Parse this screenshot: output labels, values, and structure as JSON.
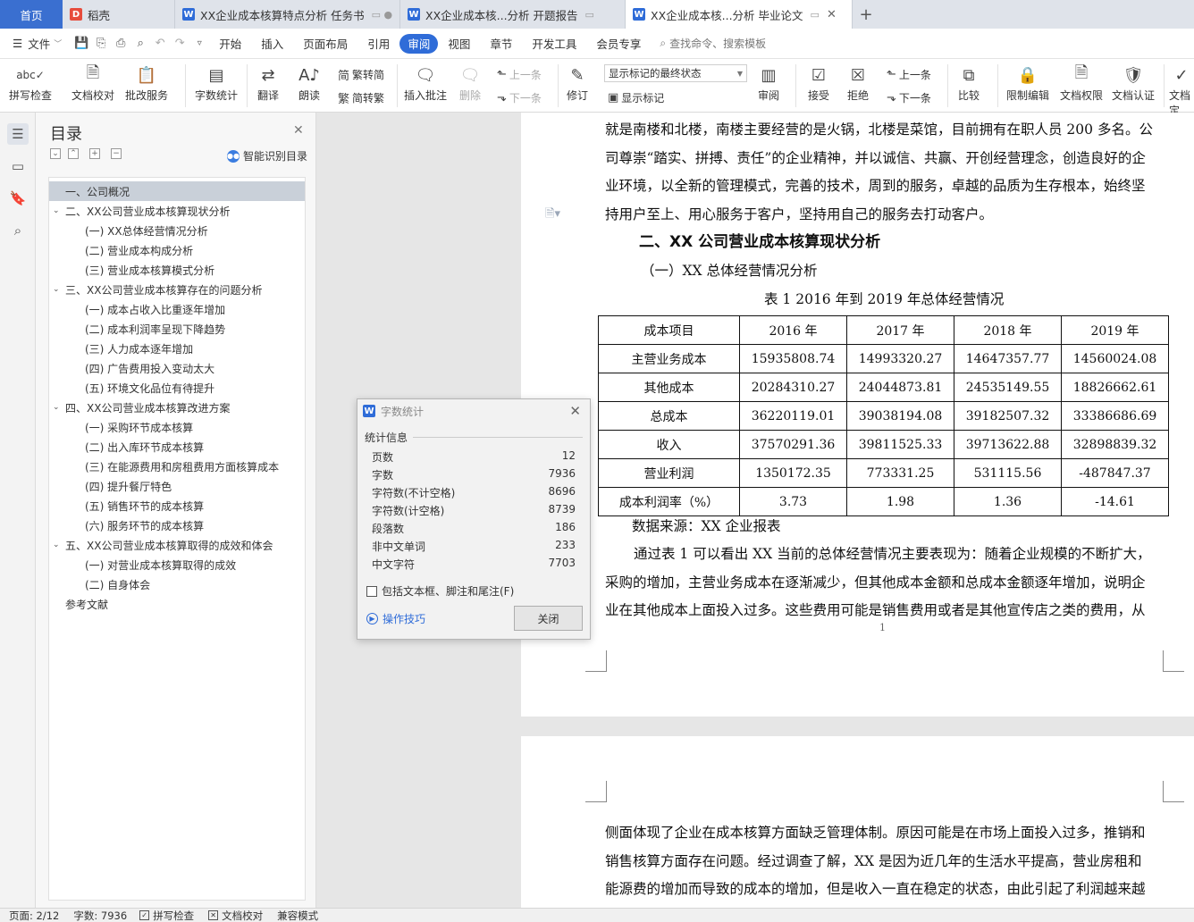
{
  "tabs": {
    "home": "首页",
    "items": [
      {
        "label": "稻壳",
        "icon": "docer-icon"
      },
      {
        "label": "XX企业成本核算特点分析 任务书",
        "icon": "wps-writer-icon"
      },
      {
        "label": "XX企业成本核...分析 开题报告",
        "icon": "wps-writer-icon"
      },
      {
        "label": "XX企业成本核...分析 毕业论文",
        "icon": "wps-writer-icon",
        "active": true
      }
    ],
    "add": "+"
  },
  "menu": {
    "file": "文件",
    "items": [
      "开始",
      "插入",
      "页面布局",
      "引用",
      "审阅",
      "视图",
      "章节",
      "开发工具",
      "会员专享"
    ],
    "active": "审阅",
    "search": "查找命令、搜索模板"
  },
  "ribbon": {
    "spell": "拼写检查",
    "proof": "文档校对",
    "batch": "批改服务",
    "wordcount": "字数统计",
    "translate": "翻译",
    "read": "朗读",
    "trad": "繁转简",
    "simp": "简转繁",
    "insert_comment": "插入批注",
    "delete": "删除",
    "prev": "上一条",
    "next": "下一条",
    "revise": "修订",
    "markup_select": "显示标记的最终状态",
    "show_markup": "显示标记",
    "review": "审阅",
    "accept": "接受",
    "reject": "拒绝",
    "prev2": "上一条",
    "next2": "下一条",
    "compare": "比较",
    "restrict": "限制编辑",
    "rights": "文档权限",
    "certify": "文档认证",
    "final": "文档定"
  },
  "toc": {
    "title": "目录",
    "smart": "智能识别目录",
    "items": [
      {
        "text": "一、公司概况",
        "level": 1,
        "caret": false,
        "selected": true
      },
      {
        "text": "二、XX公司营业成本核算现状分析",
        "level": 1,
        "caret": true
      },
      {
        "text": "(一) XX总体经营情况分析",
        "level": 2
      },
      {
        "text": "(二) 营业成本构成分析",
        "level": 2
      },
      {
        "text": "(三) 营业成本核算模式分析",
        "level": 2
      },
      {
        "text": "三、XX公司营业成本核算存在的问题分析",
        "level": 1,
        "caret": true
      },
      {
        "text": "(一) 成本占收入比重逐年增加",
        "level": 2
      },
      {
        "text": "(二) 成本利润率呈现下降趋势",
        "level": 2
      },
      {
        "text": "(三) 人力成本逐年增加",
        "level": 2
      },
      {
        "text": "(四) 广告费用投入变动太大",
        "level": 2
      },
      {
        "text": "(五) 环境文化品位有待提升",
        "level": 2
      },
      {
        "text": "四、XX公司营业成本核算改进方案",
        "level": 1,
        "caret": true
      },
      {
        "text": "(一) 采购环节成本核算",
        "level": 2
      },
      {
        "text": "(二) 出入库环节成本核算",
        "level": 2
      },
      {
        "text": "(三) 在能源费用和房租费用方面核算成本",
        "level": 2
      },
      {
        "text": "(四) 提升餐厅特色",
        "level": 2
      },
      {
        "text": "(五) 销售环节的成本核算",
        "level": 2
      },
      {
        "text": "(六) 服务环节的成本核算",
        "level": 2
      },
      {
        "text": "五、XX公司营业成本核算取得的成效和体会",
        "level": 1,
        "caret": true
      },
      {
        "text": "(一) 对营业成本核算取得的成效",
        "level": 2
      },
      {
        "text": "(二) 自身体会",
        "level": 2
      },
      {
        "text": "参考文献",
        "level": 0
      }
    ]
  },
  "doc": {
    "p1": [
      "就是南楼和北楼，南楼主要经营的是火锅，北楼是菜馆，目前拥有在职人员 200 多名。公",
      "司尊崇“踏实、拼搏、责任”的企业精神，并以诚信、共赢、开创经营理念，创造良好的企",
      "业环境，以全新的管理模式，完善的技术，周到的服务，卓越的品质为生存根本，始终坚",
      "持用户至上、用心服务于客户，坚持用自己的服务去打动客户。"
    ],
    "h2": "二、XX 公司营业成本核算现状分析",
    "h3": "（一）XX 总体经营情况分析",
    "caption": "表 1   2016 年到 2019 年总体经营情况",
    "table": {
      "header": [
        "成本项目",
        "2016 年",
        "2017 年",
        "2018 年",
        "2019 年"
      ],
      "rows": [
        [
          "主营业务成本",
          "15935808.74",
          "14993320.27",
          "14647357.77",
          "14560024.08"
        ],
        [
          "其他成本",
          "20284310.27",
          "24044873.81",
          "24535149.55",
          "18826662.61"
        ],
        [
          "总成本",
          "36220119.01",
          "39038194.08",
          "39182507.32",
          "33386686.69"
        ],
        [
          "收入",
          "37570291.36",
          "39811525.33",
          "39713622.88",
          "32898839.32"
        ],
        [
          "营业利润",
          "1350172.35",
          "773331.25",
          "531115.56",
          "-487847.37"
        ],
        [
          "成本利润率（%）",
          "3.73",
          "1.98",
          "1.36",
          "-14.61"
        ]
      ]
    },
    "source": "数据来源：XX 企业报表",
    "p2": [
      "通过表 1 可以看出 XX 当前的总体经营情况主要表现为：随着企业规模的不断扩大，",
      "采购的增加，主营业务成本在逐渐减少，但其他成本金额和总成本金额逐年增加，说明企",
      "业在其他成本上面投入过多。这些费用可能是销售费用或者是其他宣传店之类的费用，从"
    ],
    "page_num": "1",
    "p3": [
      "侧面体现了企业在成本核算方面缺乏管理体制。原因可能是在市场上面投入过多，推销和",
      "销售核算方面存在问题。经过调查了解，XX 是因为近几年的生活水平提高，营业房租和",
      "能源费的增加而导致的成本的增加，但是收入一直在稳定的状态，由此引起了利润越来越"
    ]
  },
  "dialog": {
    "title": "字数统计",
    "section": "统计信息",
    "stats": [
      {
        "label": "页数",
        "value": "12"
      },
      {
        "label": "字数",
        "value": "7936"
      },
      {
        "label": "字符数(不计空格)",
        "value": "8696"
      },
      {
        "label": "字符数(计空格)",
        "value": "8739"
      },
      {
        "label": "段落数",
        "value": "186"
      },
      {
        "label": "非中文单词",
        "value": "233"
      },
      {
        "label": "中文字符",
        "value": "7703"
      }
    ],
    "include": "包括文本框、脚注和尾注(F)",
    "tips": "操作技巧",
    "close": "关闭"
  },
  "status": {
    "page": "页面: 2/12",
    "words": "字数: 7936",
    "spell": "拼写检查",
    "proof": "文档校对",
    "compat": "兼容模式"
  }
}
